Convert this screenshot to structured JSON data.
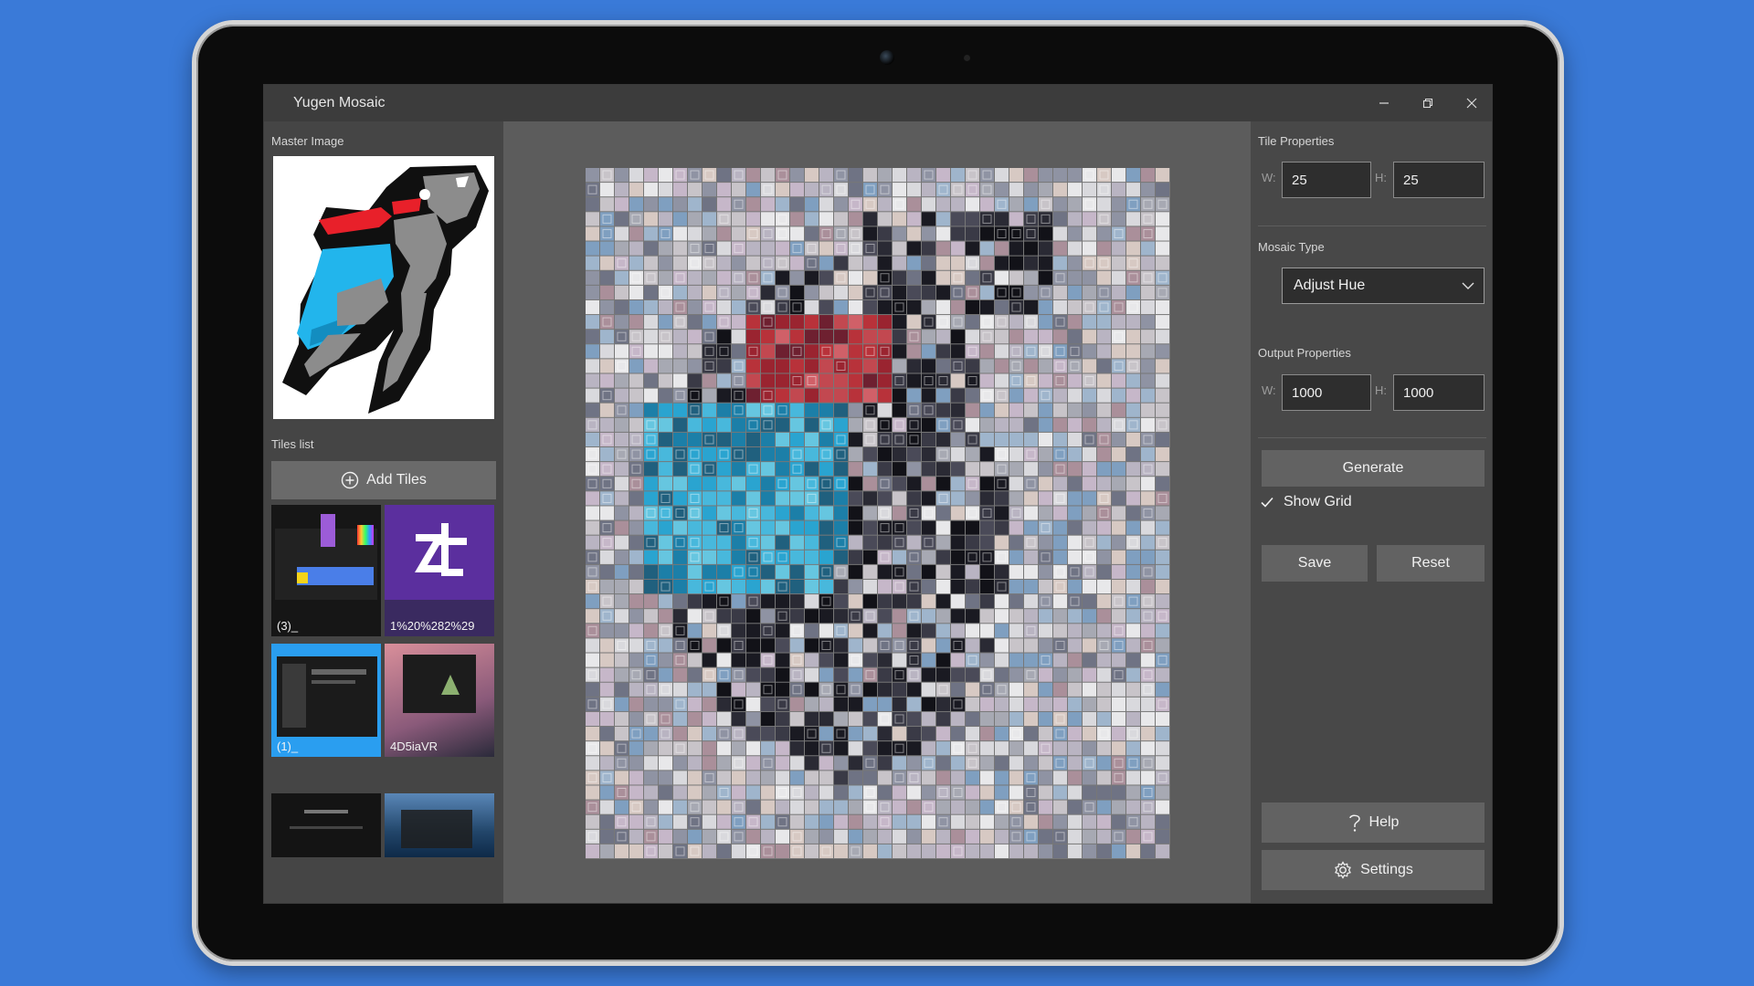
{
  "window": {
    "title": "Yugen Mosaic",
    "controls": [
      "minimize-icon",
      "restore-icon",
      "close-icon"
    ]
  },
  "left_panel": {
    "master_image_label": "Master Image",
    "tiles_list_label": "Tiles list",
    "add_tiles_label": "Add Tiles",
    "tiles": [
      {
        "label": "(3)_",
        "style": "dark-ui"
      },
      {
        "label": "1%20%282%29",
        "style": "purple-logo"
      },
      {
        "label": "(1)_",
        "style": "blue-ui"
      },
      {
        "label": "4D5iaVR",
        "style": "pink-ui"
      },
      {
        "label": "",
        "style": "black-ui"
      },
      {
        "label": "",
        "style": "sea"
      }
    ]
  },
  "right_panel": {
    "tile_properties_label": "Tile Properties",
    "tile_w_label": "W:",
    "tile_w_value": "25",
    "tile_h_label": "H:",
    "tile_h_value": "25",
    "mosaic_type_label": "Mosaic Type",
    "mosaic_type_value": "Adjust Hue",
    "output_properties_label": "Output Properties",
    "output_w_label": "W:",
    "output_w_value": "1000",
    "output_h_label": "H:",
    "output_h_value": "1000",
    "generate_label": "Generate",
    "show_grid_label": "Show Grid",
    "show_grid_checked": true,
    "save_label": "Save",
    "reset_label": "Reset",
    "help_label": "Help",
    "settings_label": "Settings"
  },
  "colors": {
    "desktop_background": "#3a7ad8",
    "titlebar": "#3c3c3c",
    "left_panel": "#454545",
    "canvas_area": "#5c5c5c",
    "right_panel": "#484848",
    "master_red": "#e8202a",
    "master_cyan": "#22b5ec",
    "master_gray": "#8c8c8c"
  }
}
